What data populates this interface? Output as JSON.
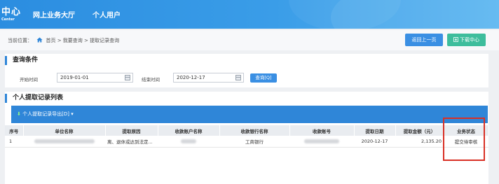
{
  "header": {
    "logo_main": "中心",
    "logo_sub": "Center",
    "nav": [
      "网上业务大厅",
      "个人用户"
    ]
  },
  "breadcrumb": {
    "label": "当前位置：",
    "path": "首页 > 我要查询 > 提取记录查询"
  },
  "actions": {
    "back": "返回上一页",
    "download": "下载中心"
  },
  "query": {
    "title": "查询条件",
    "start_label": "开始时间",
    "start_value": "2019-01-01",
    "end_label": "结束时间",
    "end_value": "2020-12-17",
    "search_button": "查询[Q]"
  },
  "list": {
    "title": "个人提取记录列表",
    "export_label": "个人提取记录导出[D]",
    "columns": [
      "序号",
      "单位名称",
      "提取原因",
      "收款账户名称",
      "收款银行名称",
      "收款账号",
      "提取日期",
      "提取金额（元）",
      "业务状态"
    ],
    "rows": [
      {
        "index": "1",
        "reason": "离、退休或达到法定...",
        "bank": "工商银行",
        "date": "2020-12-17",
        "amount": "2,135.20",
        "status": "提交待审核"
      }
    ]
  },
  "colors": {
    "header_blue": "#2b8de0",
    "primary": "#3a8fe3",
    "teal": "#3dbd9c",
    "highlight": "#d93025"
  }
}
